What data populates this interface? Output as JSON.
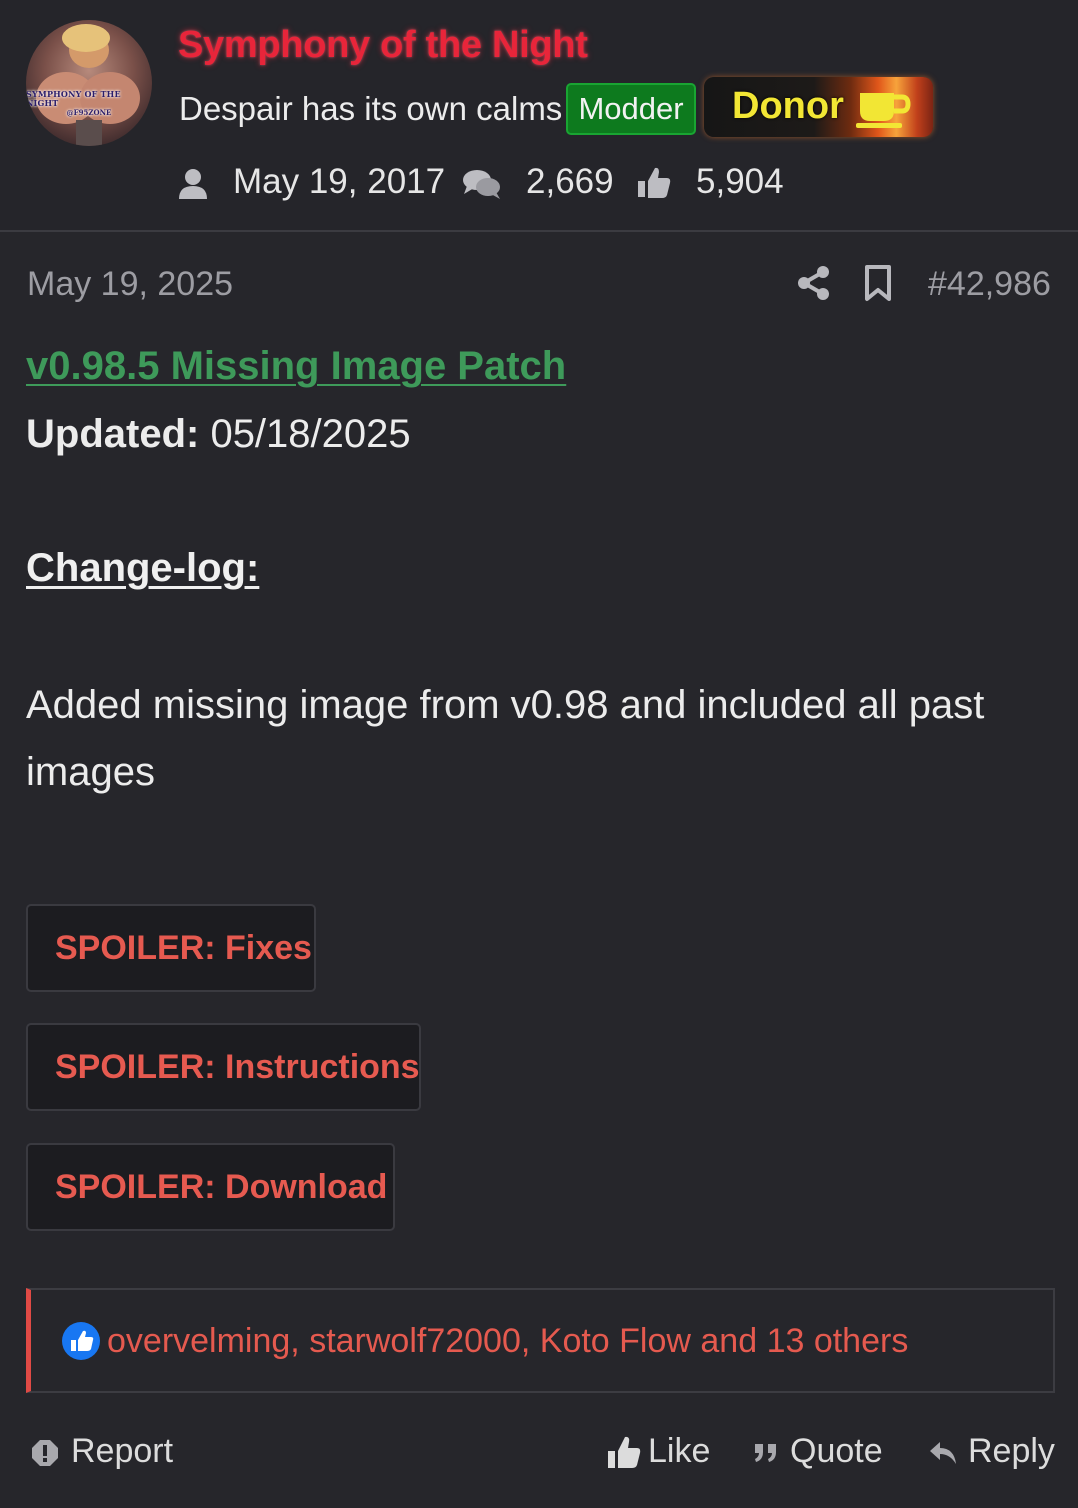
{
  "author": {
    "avatar_banner_line1": "SYMPHONY OF THE NIGHT",
    "avatar_banner_line2": "@F95ZONE",
    "username": "Symphony of the Night",
    "title": "Despair has its own calms",
    "badges": {
      "modder": "Modder",
      "donor": "Donor"
    },
    "stats": {
      "joined": "May 19, 2017",
      "messages": "2,669",
      "reactions": "5,904"
    }
  },
  "post": {
    "date": "May 19, 2025",
    "number": "#42,986",
    "link_title": "v0.98.5 Missing Image Patch",
    "updated_label": "Updated:",
    "updated_value": " 05/18/2025",
    "changelog_heading": "Change-log:",
    "changelog_text": "Added missing image from v0.98 and included all past images",
    "spoilers": [
      {
        "label": "SPOILER: Fixes"
      },
      {
        "label": "SPOILER: Instructions"
      },
      {
        "label": "SPOILER: Download"
      }
    ]
  },
  "reactions": {
    "users_text": "overvelming, starwolf72000, Koto Flow and 13 others"
  },
  "actions": {
    "report": "Report",
    "like": "Like",
    "quote": "Quote",
    "reply": "Reply"
  },
  "colors": {
    "background": "#26262b",
    "username": "#e8253a",
    "link": "#3e9a5a",
    "spoiler_text": "#e65a50",
    "modder_badge": "#0d7a1e",
    "donor_text": "#f2e634",
    "reaction_accent": "#e04a45",
    "like_icon": "#1877f2"
  },
  "icons": {
    "stats": [
      "user-icon",
      "comments-icon",
      "thumbs-up-icon"
    ],
    "meta": [
      "share-icon",
      "bookmark-icon"
    ],
    "actions": [
      "report-icon",
      "like-icon",
      "quote-icon",
      "reply-icon"
    ]
  }
}
